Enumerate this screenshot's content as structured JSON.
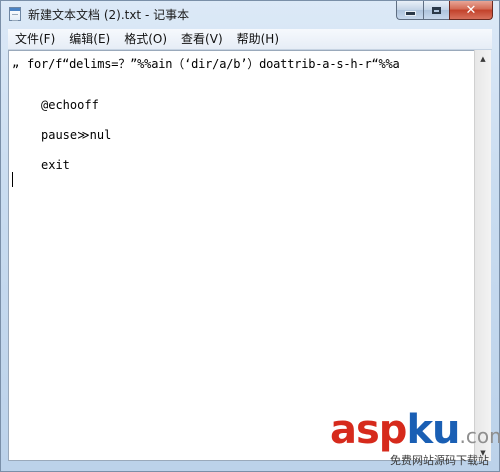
{
  "window": {
    "title": "新建文本文档 (2).txt - 记事本",
    "minimize_icon": "minimize-icon",
    "maximize_icon": "maximize-icon",
    "close_label": "✕"
  },
  "menu": {
    "items": [
      {
        "label": "文件(F)"
      },
      {
        "label": "编辑(E)"
      },
      {
        "label": "格式(O)"
      },
      {
        "label": "查看(V)"
      },
      {
        "label": "帮助(H)"
      }
    ]
  },
  "editor": {
    "lines": [
      "for/f“delims=？”%%ain（‘dir/a/b’）doattrib-a-s-h-r“%%a",
      "”",
      "@echooff",
      "pause≫nul",
      "exit"
    ]
  },
  "scrollbar": {
    "up_icon": "scroll-up-arrow-icon",
    "down_icon": "scroll-down-arrow-icon"
  },
  "watermark": {
    "asp": "asp",
    "ku": "ku",
    "com": ".com",
    "subtitle": "免费网站源码下载站"
  }
}
